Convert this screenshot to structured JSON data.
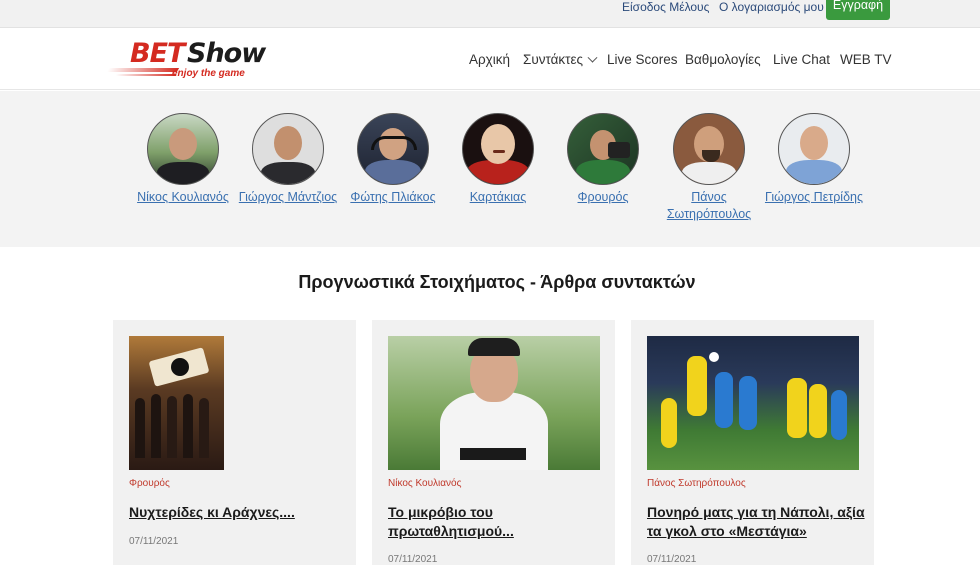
{
  "topbar": {
    "login": "Είσοδος Μέλους",
    "account": "Ο λογαριασμός μου",
    "register": "Εγγραφή"
  },
  "logo": {
    "bet": "BET",
    "show": "Show",
    "tagline": "enjoy the game"
  },
  "nav": {
    "home": "Αρχική",
    "writers": "Συντάκτες",
    "livescores": "Live Scores",
    "standings": "Βαθμολογίες",
    "livechat": "Live Chat",
    "webtv": "WEB TV"
  },
  "authors": [
    {
      "name": "Νίκος Κουλιανός"
    },
    {
      "name": "Γιώργος Μάντζιος"
    },
    {
      "name": "Φώτης Πλιάκος"
    },
    {
      "name": "Καρτάκιας"
    },
    {
      "name": "Φρουρός"
    },
    {
      "name": "Πάνος Σωτηρόπουλος"
    },
    {
      "name": "Γιώργος Πετρίδης"
    }
  ],
  "section_title": "Προγνωστικά Στοιχήματος - Άρθρα συντακτών",
  "articles": [
    {
      "author": "Φρουρός",
      "title": "Νυχτερίδες κι Αράχνες....",
      "date": "07/11/2021"
    },
    {
      "author": "Νίκος Κουλιανός",
      "title": "Το μικρόβιο του πρωταθλητισμού...",
      "date": "07/11/2021"
    },
    {
      "author": "Πάνος Σωτηρόπουλος",
      "title": "Πονηρό ματς για τη Νάπολι, αξία τα γκολ στο «Μεστάγια»",
      "date": "07/11/2021"
    }
  ],
  "colors": {
    "brand_red": "#d42a20",
    "register_green": "#3a9a3e",
    "link_blue": "#3a70b0"
  }
}
